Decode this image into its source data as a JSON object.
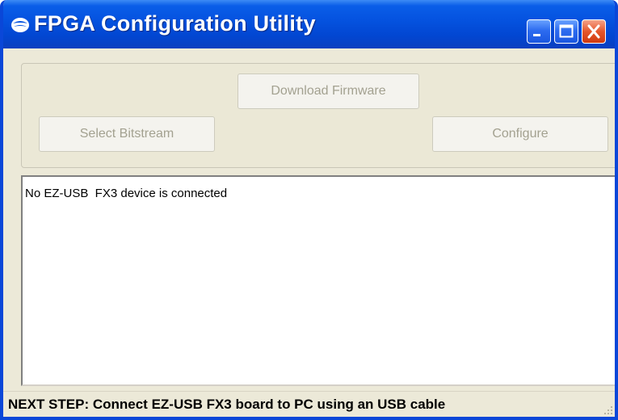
{
  "window": {
    "title": "FPGA Configuration Utility",
    "app_icon": "cypress-logo-icon",
    "controls": {
      "minimize": "minimize-icon",
      "maximize": "maximize-icon",
      "close": "close-icon"
    }
  },
  "buttons": {
    "download_firmware": "Download Firmware",
    "select_bitstream": "Select Bitstream",
    "configure": "Configure",
    "enabled": false
  },
  "log": {
    "lines": [
      "No EZ-USB  FX3 device is connected"
    ]
  },
  "status": {
    "text": "NEXT STEP: Connect EZ-USB FX3 board to PC using an USB cable"
  },
  "colors": {
    "titlebar": "#0553e0",
    "window_bg": "#ece9d8",
    "close_button": "#e5562a",
    "disabled_text": "#a3a190"
  }
}
